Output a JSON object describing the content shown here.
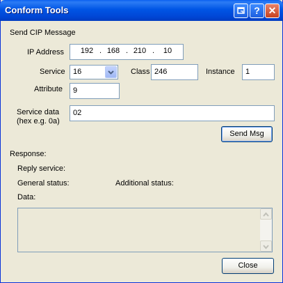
{
  "window": {
    "title": "Conform Tools"
  },
  "section": {
    "heading": "Send CIP Message"
  },
  "form": {
    "ip_label": "IP Address",
    "ip_octets": [
      "192",
      "168",
      "210",
      "10"
    ],
    "ip_separator": ".",
    "service_label": "Service",
    "service_value": "16",
    "class_label": "Class",
    "class_value": "246",
    "instance_label": "Instance",
    "instance_value": "1",
    "attribute_label": "Attribute",
    "attribute_value": "9",
    "service_data_label_1": "Service data",
    "service_data_label_2": "(hex e.g. 0a)",
    "service_data_value": "02",
    "send_button": "Send Msg"
  },
  "response": {
    "heading": "Response:",
    "reply_service_label": "Reply service:",
    "general_status_label": "General status:",
    "additional_status_label": "Additional status:",
    "data_label": "Data:"
  },
  "close_button": "Close",
  "icons": [
    "restore-icon",
    "help-icon",
    "close-icon",
    "chevron-down-icon",
    "scroll-up-icon",
    "scroll-down-icon"
  ],
  "colors": {
    "titlebar": "#0055e5",
    "window_bg": "#ece9d8",
    "field_border": "#7f9db9"
  }
}
